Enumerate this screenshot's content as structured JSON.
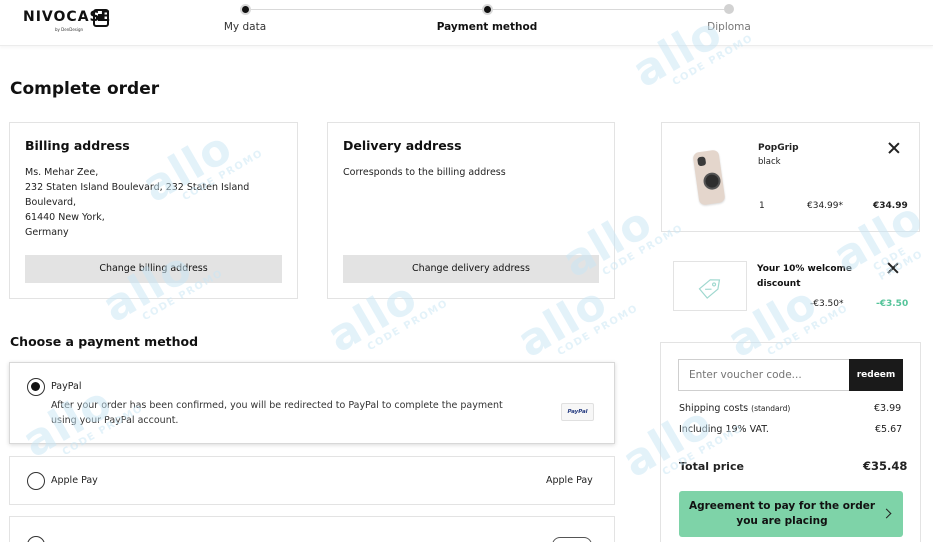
{
  "header": {
    "logo_text": "NIVOCASE",
    "logo_sub": "by DenDesign",
    "steps": [
      {
        "label": "My data",
        "state": "done"
      },
      {
        "label": "Payment method",
        "state": "active"
      },
      {
        "label": "Diploma",
        "state": "todo"
      }
    ]
  },
  "page_title": "Complete order",
  "billing": {
    "title": "Billing address",
    "lines": [
      "Ms. Mehar Zee,",
      "232 Staten Island Boulevard, 232 Staten Island",
      "Boulevard,",
      "61440 New York,",
      "Germany"
    ],
    "button": "Change billing address"
  },
  "delivery": {
    "title": "Delivery address",
    "text": "Corresponds to the billing address",
    "button": "Change delivery address"
  },
  "payment": {
    "section_title": "Choose a payment method",
    "options": [
      {
        "label": "PayPal",
        "selected": true,
        "description": "After your order has been confirmed, you will be redirected to PayPal to complete the payment using your PayPal account.",
        "badge": "PayPal"
      },
      {
        "label": "Apple Pay",
        "selected": false,
        "right_label": "Apple Pay"
      },
      {
        "label": "",
        "selected": false
      }
    ]
  },
  "cart": {
    "product": {
      "name": "PopGrip",
      "variant": "black",
      "qty": "1",
      "unit_price": "€34.99*",
      "total": "€34.99"
    },
    "discount": {
      "name": "Your 10% welcome discount",
      "amount": "-€3.50*",
      "total": "-€3.50"
    }
  },
  "summary": {
    "voucher_placeholder": "Enter voucher code...",
    "redeem_label": "redeem",
    "shipping_label": "Shipping costs",
    "shipping_note": "(standard)",
    "shipping_value": "€3.99",
    "vat_label": "Including 19% VAT.",
    "vat_value": "€5.67",
    "total_label": "Total price",
    "total_value": "€35.48",
    "cta": "Agreement to pay for the order you are placing"
  },
  "watermark": {
    "big": "allo",
    "small": "CODE PROMO"
  },
  "colors": {
    "accent_green": "#7ed3a8",
    "discount_green": "#55c49a",
    "watermark": "#c8e6f5"
  }
}
